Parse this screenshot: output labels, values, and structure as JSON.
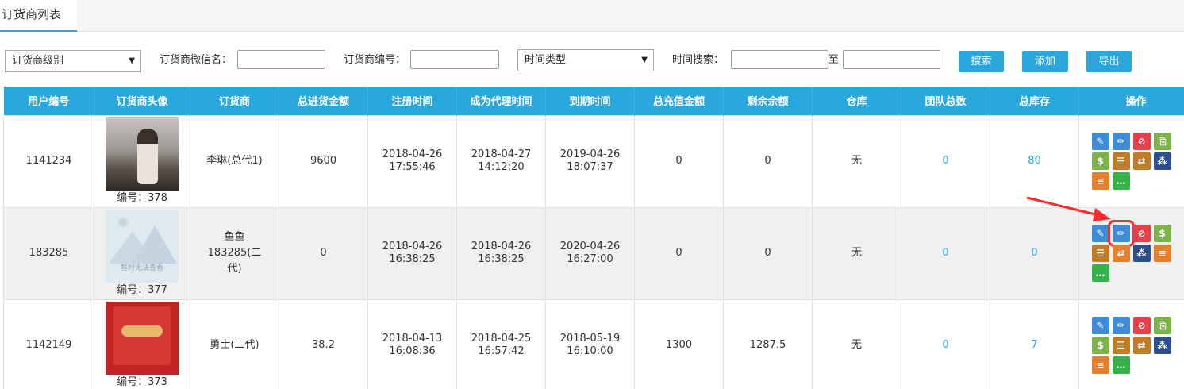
{
  "tab": {
    "label": "订货商列表"
  },
  "filters": {
    "level_select": "订货商级别",
    "wechat_label": "订货商微信名：",
    "code_label": "订货商编号：",
    "time_type_select": "时间类型",
    "time_search_label": "时间搜索：",
    "range_sep": "至",
    "search_btn": "搜索",
    "add_btn": "添加",
    "export_btn": "导出"
  },
  "columns": [
    "用户编号",
    "订货商头像",
    "订货商",
    "总进货金额",
    "注册时间",
    "成为代理时间",
    "到期时间",
    "总充值金额",
    "剩余余额",
    "仓库",
    "团队总数",
    "总库存",
    "操作"
  ],
  "avatar_placeholder_text": "暂时无法查看",
  "rows": [
    {
      "user_id": "1141234",
      "avatar_caption": "编号：378",
      "name": "李琳(总代1)",
      "total_purchase": "9600",
      "register_date": "2018-04-26",
      "register_time": "17:55:46",
      "agent_date": "2018-04-27",
      "agent_time": "14:12:20",
      "expire_date": "2019-04-26",
      "expire_time": "18:07:37",
      "total_recharge": "0",
      "balance": "0",
      "warehouse": "无",
      "team_total": "0",
      "total_stock": "80"
    },
    {
      "user_id": "183285",
      "avatar_caption": "编号：377",
      "name_line1": "鱼鱼",
      "name_line2": "183285(二",
      "name_line3": "代)",
      "total_purchase": "0",
      "register_date": "2018-04-26",
      "register_time": "16:38:25",
      "agent_date": "2018-04-26",
      "agent_time": "16:38:25",
      "expire_date": "2020-04-26",
      "expire_time": "16:27:00",
      "total_recharge": "0",
      "balance": "0",
      "warehouse": "无",
      "team_total": "0",
      "total_stock": "0"
    },
    {
      "user_id": "1142149",
      "avatar_caption": "编号：373",
      "name": "勇士(二代)",
      "total_purchase": "38.2",
      "register_date": "2018-04-13",
      "register_time": "16:08:36",
      "agent_date": "2018-04-25",
      "agent_time": "16:57:42",
      "expire_date": "2018-05-19",
      "expire_time": "16:10:00",
      "total_recharge": "1300",
      "balance": "1287.5",
      "warehouse": "无",
      "team_total": "0",
      "total_stock": "7"
    }
  ],
  "icons": {
    "row1": [
      "review-icon",
      "edit-icon",
      "disable-icon",
      "recharge-icon",
      "money-icon",
      "list-icon",
      "transfer-icon",
      "team-icon",
      "order-log-icon",
      "chat-icon"
    ],
    "row2_highlighted": "edit-icon",
    "colors": {
      "blue": "#3f8bd6",
      "red": "#e5414a",
      "green": "#7db24c",
      "brown": "#c17c2a",
      "orange": "#e67f2e",
      "navy": "#2d4f8e",
      "chat": "#35b34a",
      "header": "#2aa7dd",
      "annotation": "#ff2a2a"
    }
  }
}
